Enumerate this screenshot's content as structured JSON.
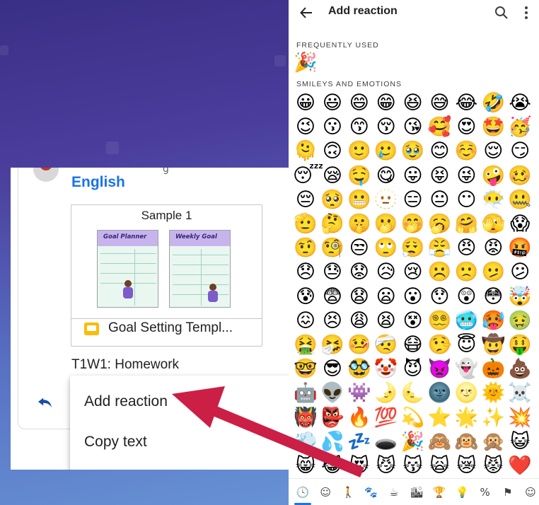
{
  "chat_card": {
    "sender_fragment": "g",
    "class_name": "English",
    "attachment": {
      "title": "Sample 1",
      "thumbnail_left_title": "Goal Planner",
      "thumbnail_right_title": "Weekly Goal",
      "file_icon": "google-slides-icon",
      "file_name": "Goal Setting Templ..."
    },
    "post_title": "T1W1: Homework",
    "reply_icon": "reply-icon"
  },
  "context_menu": {
    "items": [
      {
        "label": "Add reaction"
      },
      {
        "label": "Copy text"
      }
    ]
  },
  "emoji_picker": {
    "title": "Add reaction",
    "back_icon": "arrow-left-icon",
    "search_icon": "search-icon",
    "more_icon": "more-vertical-icon",
    "sections": {
      "frequently_used": {
        "label": "FREQUENTLY USED",
        "emojis": [
          "🎉"
        ]
      },
      "smileys_and_emotions": {
        "label": "SMILEYS AND EMOTIONS",
        "rows": [
          [
            "😀",
            "😃",
            "😄",
            "😁",
            "😆",
            "😅",
            "😂",
            "🤣",
            "😭"
          ],
          [
            "😉",
            "😗",
            "😙",
            "😚",
            "😘",
            "🥰",
            "😍",
            "🤩",
            "🥳"
          ],
          [
            "🫠",
            "🙃",
            "🙂",
            "🥲",
            "🥹",
            "😊",
            "☺️",
            "😌",
            "😏"
          ],
          [
            "😴",
            "😪",
            "🤤",
            "😋",
            "😛",
            "😝",
            "😜",
            "🤪",
            "🥴"
          ],
          [
            "😔",
            "🥺",
            "😬",
            "🫥",
            "😑",
            "😐",
            "😶",
            "😶‍🌫️",
            "🤐"
          ],
          [
            "🫡",
            "🤔",
            "🤫",
            "🫢",
            "🤭",
            "🥱",
            "🤗",
            "🫣",
            "😱"
          ],
          [
            "🤨",
            "🧐",
            "😒",
            "🙄",
            "😮‍💨",
            "😤",
            "😠",
            "😡",
            "🤬"
          ],
          [
            "😞",
            "😓",
            "😟",
            "😥",
            "😢",
            "☹️",
            "🙁",
            "🫤",
            "😕"
          ],
          [
            "😰",
            "😨",
            "😧",
            "😦",
            "😮",
            "😯",
            "😲",
            "😳",
            "🤯"
          ],
          [
            "😖",
            "😣",
            "😩",
            "😫",
            "😵",
            "😵‍💫",
            "🥶",
            "🥵",
            "🤢"
          ],
          [
            "🤮",
            "🤧",
            "🤒",
            "🤕",
            "😷",
            "🤥",
            "😇",
            "🤠",
            "🤑"
          ],
          [
            "🤓",
            "😎",
            "🥸",
            "🤡",
            "😈",
            "👿",
            "👻",
            "🎃",
            "💩"
          ],
          [
            "🤖",
            "👽",
            "👾",
            "🌛",
            "🌜",
            "🌚",
            "🌝",
            "🌞",
            "☠️"
          ],
          [
            "👹",
            "👺",
            "🔥",
            "💯",
            "💫",
            "⭐",
            "🌟",
            "✨",
            "💥"
          ],
          [
            "💨",
            "💦",
            "💤",
            "🕳️",
            "🎉",
            "🙈",
            "🙉",
            "🙊",
            "😺"
          ],
          [
            "😸",
            "😹",
            "😻",
            "😼",
            "😽",
            "🙀",
            "😿",
            "😾",
            "❤️"
          ]
        ]
      }
    },
    "categories": [
      {
        "icon": "clock-icon",
        "glyph": "🕓"
      },
      {
        "icon": "smiley-icon",
        "glyph": "☺"
      },
      {
        "icon": "person-icon",
        "glyph": "🚶"
      },
      {
        "icon": "animal-icon",
        "glyph": "🐾"
      },
      {
        "icon": "food-icon",
        "glyph": "☕"
      },
      {
        "icon": "travel-icon",
        "glyph": "🏙"
      },
      {
        "icon": "activity-icon",
        "glyph": "🏆"
      },
      {
        "icon": "objects-icon",
        "glyph": "💡"
      },
      {
        "icon": "symbols-icon",
        "glyph": "%"
      },
      {
        "icon": "flag-icon",
        "glyph": "⚑"
      },
      {
        "icon": "custom-emoji-icon",
        "glyph": "☺"
      }
    ]
  },
  "colors": {
    "accent_blue": "#1a73e8",
    "annotation_arrow": "#cc1f45",
    "slides_yellow": "#fbbc04"
  }
}
